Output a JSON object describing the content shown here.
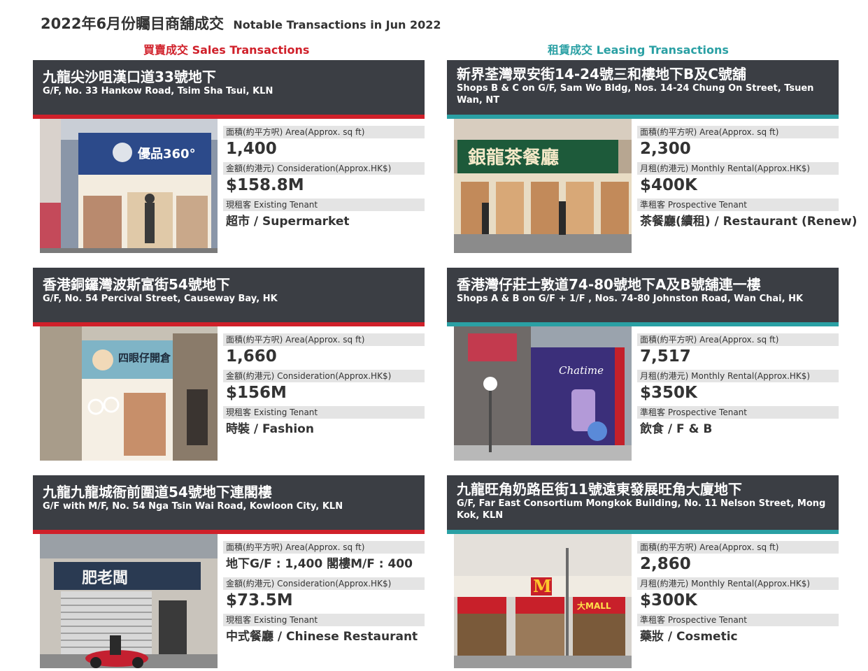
{
  "page": {
    "title_zh": "2022年6月份矚目商舖成交",
    "title_en": "Notable Transactions in Jun 2022",
    "sales_heading": "買賣成交 Sales Transactions",
    "leasing_heading": "租賃成交 Leasing Transactions"
  },
  "colors": {
    "sales_accent": "#d0202a",
    "leasing_accent": "#2aa0a4",
    "header_bg": "#3b3e44"
  },
  "sales": [
    {
      "address_zh": "九龍尖沙咀漢口道33號地下",
      "address_en": "G/F, No. 33 Hankow Road, Tsim Sha Tsui, KLN",
      "area_label": "面積(約平方呎) Area(Approx. sq ft)",
      "area": "1,400",
      "price_label": "金額(約港元) Consideration(Approx.HK$)",
      "price": "$158.8M",
      "tenant_label": "現租客 Existing Tenant",
      "tenant": "超市 / Supermarket",
      "sign_text": "優品360°"
    },
    {
      "address_zh": "香港銅鑼灣波斯富街54號地下",
      "address_en": "G/F, No. 54 Percival Street, Causeway Bay, HK",
      "area_label": "面積(約平方呎) Area(Approx. sq ft)",
      "area": "1,660",
      "price_label": "金額(約港元) Consideration(Approx.HK$)",
      "price": "$156M",
      "tenant_label": "現租客 Existing Tenant",
      "tenant": "時裝 / Fashion",
      "sign_text": "四眼仔開倉"
    },
    {
      "address_zh": "九龍九龍城衙前圍道54號地下連閣樓",
      "address_en": "G/F with M/F, No. 54 Nga Tsin Wai Road, Kowloon City, KLN",
      "area_label": "面積(約平方呎) Area(Approx. sq ft)",
      "area": "地下G/F : 1,400 閣樓M/F : 400",
      "price_label": "金額(約港元) Consideration(Approx.HK$)",
      "price": "$73.5M",
      "tenant_label": "現租客 Existing Tenant",
      "tenant": "中式餐廳 / Chinese Restaurant",
      "sign_text": "肥老闆"
    }
  ],
  "leasing": [
    {
      "address_zh": "新界荃灣眾安街14-24號三和樓地下B及C號舖",
      "address_en": "Shops B & C on G/F, Sam Wo Bldg, Nos. 14-24 Chung On Street, Tsuen Wan, NT",
      "area_label": "面積(約平方呎) Area(Approx. sq ft)",
      "area": "2,300",
      "price_label": "月租(約港元) Monthly Rental(Approx.HK$)",
      "price": "$400K",
      "tenant_label": "準租客 Prospective Tenant",
      "tenant": "茶餐廳(續租) / Restaurant (Renew)",
      "sign_text": "銀龍茶餐廳"
    },
    {
      "address_zh": "香港灣仔莊士敦道74-80號地下A及B號舖連一樓",
      "address_en": "Shops A & B on G/F + 1/F , Nos. 74-80 Johnston Road, Wan Chai, HK",
      "area_label": "面積(約平方呎) Area(Approx. sq ft)",
      "area": "7,517",
      "price_label": "月租(約港元) Monthly Rental(Approx.HK$)",
      "price": "$350K",
      "tenant_label": "準租客 Prospective Tenant",
      "tenant": "飲食 / F & B",
      "sign_text": "Chatime"
    },
    {
      "address_zh": "九龍旺角奶路臣街11號遠東發展旺角大廈地下",
      "address_en": "G/F, Far East Consortium Mongkok Building, No. 11 Nelson Street, Mong Kok, KLN",
      "area_label": "面積(約平方呎) Area(Approx. sq ft)",
      "area": "2,860",
      "price_label": "月租(約港元) Monthly Rental(Approx.HK$)",
      "price": "$300K",
      "tenant_label": "準租客 Prospective Tenant",
      "tenant": "藥妝 / Cosmetic",
      "sign_text": "大MALL"
    }
  ]
}
